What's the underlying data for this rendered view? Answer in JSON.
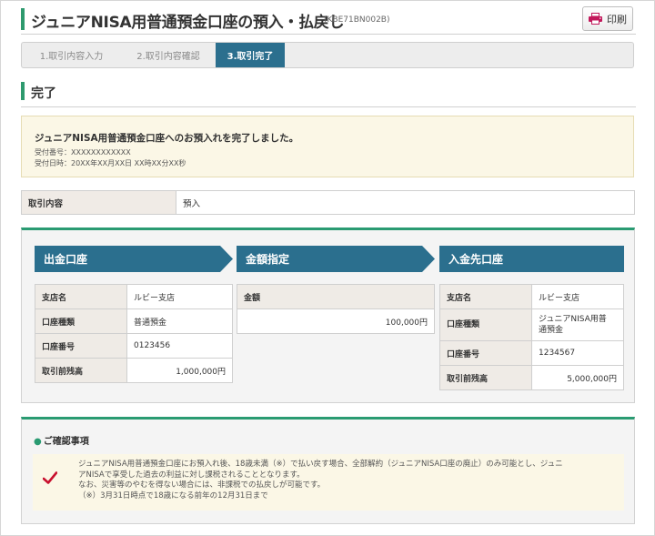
{
  "header": {
    "title": "ジュニアNISA用普通預金口座の預入・払戻し",
    "code": "(KBE71BN002B)",
    "print_label": "印刷"
  },
  "steps": [
    {
      "label": "1.取引内容入力",
      "active": false
    },
    {
      "label": "2.取引内容確認",
      "active": false
    },
    {
      "label": "3.取引完了",
      "active": true
    }
  ],
  "section": {
    "title": "完了"
  },
  "message": {
    "main": "ジュニアNISA用普通預金口座へのお預入れを完了しました。",
    "receipt_no": "受付番号：XXXXXXXXXXXX",
    "receipt_date": "受付日時：20XX年XX月XX日 XX時XX分XX秒"
  },
  "transaction": {
    "label": "取引内容",
    "value": "預入"
  },
  "from_account": {
    "heading": "出金口座",
    "rows": [
      {
        "label": "支店名",
        "value": "ルビー支店"
      },
      {
        "label": "口座種類",
        "value": "普通預金"
      },
      {
        "label": "口座番号",
        "value": "0123456"
      },
      {
        "label": "取引前残高",
        "value": "1,000,000円"
      }
    ]
  },
  "amount": {
    "heading": "金額指定",
    "label": "金額",
    "value": "100,000円"
  },
  "to_account": {
    "heading": "入金先口座",
    "rows": [
      {
        "label": "支店名",
        "value": "ルビー支店"
      },
      {
        "label": "口座種類",
        "value_line1": "ジュニアNISA用普",
        "value_line2": "通預金"
      },
      {
        "label": "口座番号",
        "value": "1234567"
      },
      {
        "label": "取引前残高",
        "value": "5,000,000円"
      }
    ]
  },
  "confirm": {
    "title": "ご確認事項",
    "lines": [
      "ジュニアNISA用普通預金口座にお預入れ後、18歳未満（※）で払い戻す場合、全部解約（ジュニアNISA口座の廃止）のみ可能とし、ジュニ",
      "アNISAで享受した過去の利益に対し課税されることとなります。",
      "なお、災害等のやむを得ない場合には、非課税での払戻しが可能です。",
      "（※）3月31日時点で18歳になる前年の12月31日まで"
    ]
  },
  "colors": {
    "accent_green": "#2e9a6e",
    "step_active": "#2b6f8e",
    "column_header": "#2b6f8e",
    "check_red": "#c8102e"
  },
  "icons": {
    "print": "printer-icon",
    "check": "checkmark-icon"
  }
}
